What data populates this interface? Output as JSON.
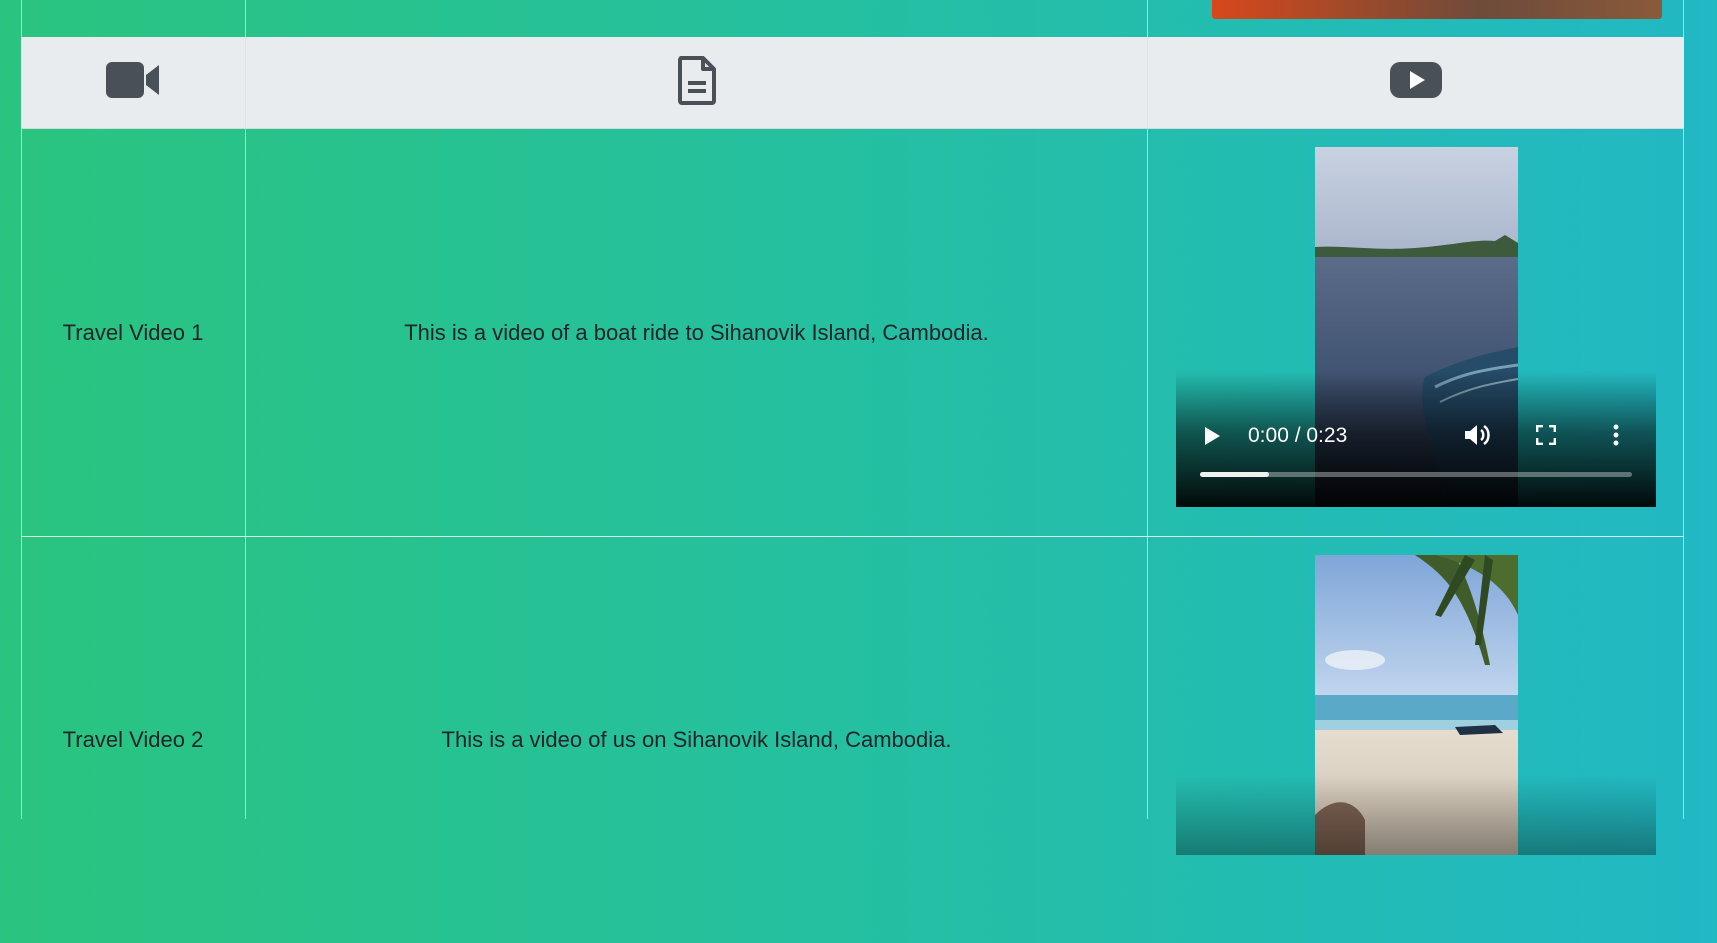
{
  "header": {
    "icons": [
      "video-camera-icon",
      "document-icon",
      "youtube-icon"
    ]
  },
  "rows": [
    {
      "title": "Travel Video 1",
      "description": "This is a video of a boat ride to Sihanovik Island, Cambodia.",
      "video": {
        "time": "0:00 / 0:23",
        "progress": 0.16
      }
    },
    {
      "title": "Travel Video 2",
      "description": "This is a video of us on Sihanovik Island, Cambodia."
    }
  ],
  "colors": {
    "bg_left": "#2ac47f",
    "bg_right": "#22b8c4",
    "header_bg": "#e9ecef",
    "icon": "#495057"
  }
}
